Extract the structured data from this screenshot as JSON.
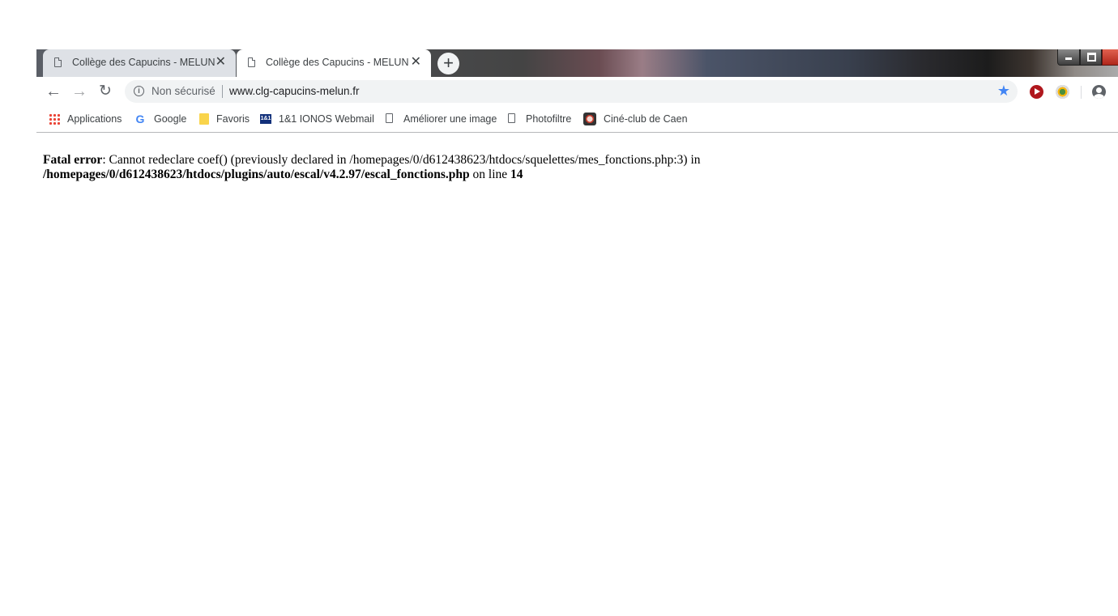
{
  "tabs": [
    {
      "title": "Collège des Capucins - MELUN",
      "close": "✕",
      "active": false
    },
    {
      "title": "Collège des Capucins - MELUN",
      "close": "✕",
      "active": true
    }
  ],
  "new_tab_label": "+",
  "toolbar": {
    "security_label": "Non sécurisé",
    "url": "www.clg-capucins-melun.fr",
    "back_glyph": "←",
    "forward_glyph": "→",
    "reload_glyph": "↻",
    "star_glyph": "★",
    "info_glyph": "i"
  },
  "bookmarks": [
    {
      "label": "Applications",
      "icon": "apps-grid-icon"
    },
    {
      "label": "Google",
      "icon": "google-icon"
    },
    {
      "label": "Favoris",
      "icon": "folder-icon"
    },
    {
      "label": "1&1 IONOS Webmail",
      "icon": "ionos-icon"
    },
    {
      "label": "Améliorer une image",
      "icon": "page-icon"
    },
    {
      "label": "Photofiltre",
      "icon": "page-icon"
    },
    {
      "label": "Ciné-club de Caen",
      "icon": "film-icon"
    }
  ],
  "google_glyph": "G",
  "ionos_glyph": "1&1",
  "error": {
    "label": "Fatal error",
    "message": ": Cannot redeclare coef() (previously declared in /homepages/0/d612438623/htdocs/squelettes/mes_fonctions.php:3) in",
    "path": "/homepages/0/d612438623/htdocs/plugins/auto/escal/v4.2.97/escal_fonctions.php",
    "line_text": " on line ",
    "line_number": "14"
  }
}
